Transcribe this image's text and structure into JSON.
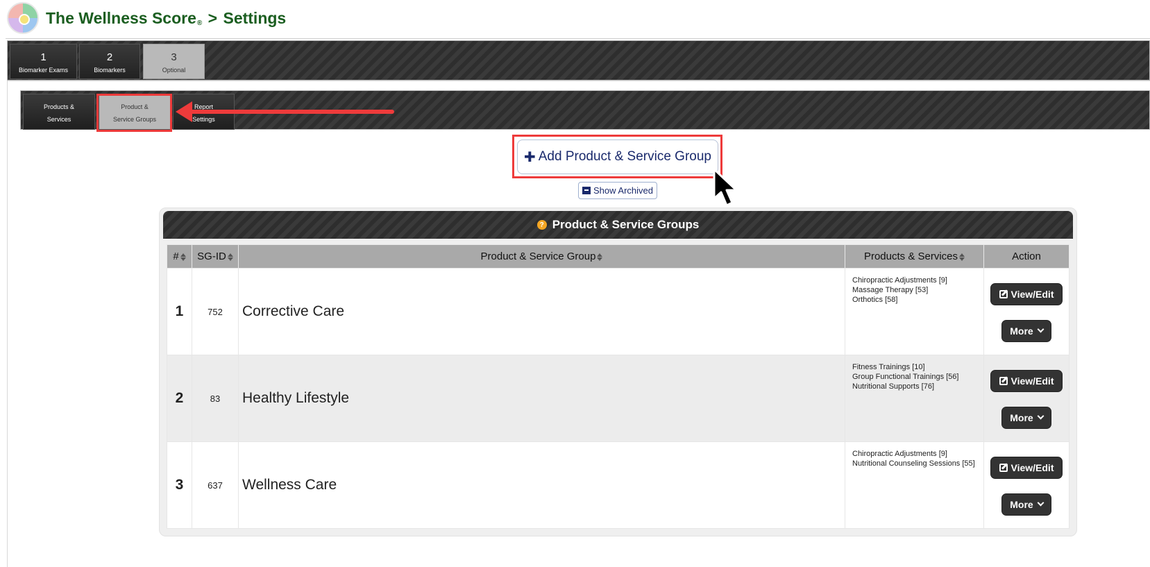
{
  "header": {
    "title": "The Wellness Score",
    "registered": "®",
    "separator": ">",
    "section": "Settings"
  },
  "top_tabs": [
    {
      "number": "1",
      "label": "Biomarker Exams",
      "active": false
    },
    {
      "number": "2",
      "label": "Biomarkers",
      "active": false
    },
    {
      "number": "3",
      "label": "Optional",
      "active": true
    }
  ],
  "sub_tabs": [
    {
      "line1": "Products &",
      "line2": "Services",
      "active": false
    },
    {
      "line1": "Product &",
      "line2": "Service Groups",
      "active": true
    },
    {
      "line1": "Report",
      "line2": "Settings",
      "active": false
    }
  ],
  "actions": {
    "add_label": "Add Product & Service Group",
    "add_icon": "plus-icon",
    "show_archived_label": "Show Archived",
    "archive_icon": "archive-box-icon"
  },
  "table": {
    "title": "Product & Service Groups",
    "help_icon": "question-circle-icon",
    "columns": {
      "num": "#",
      "sgid": "SG-ID",
      "group": "Product & Service Group",
      "products": "Products & Services",
      "action": "Action"
    },
    "view_label": "View/Edit",
    "more_label": "More",
    "rows": [
      {
        "num": "1",
        "sgid": "752",
        "name": "Corrective Care",
        "products": [
          "Chiropractic Adjustments [9]",
          "Massage Therapy [53]",
          "Orthotics [58]"
        ]
      },
      {
        "num": "2",
        "sgid": "83",
        "name": "Healthy Lifestyle",
        "products": [
          "Fitness Trainings [10]",
          "Group Functional Trainings [56]",
          "Nutritional Supports [76]"
        ]
      },
      {
        "num": "3",
        "sgid": "637",
        "name": "Wellness Care",
        "products": [
          "Chiropractic Adjustments [9]",
          "Nutritional Counseling Sessions [55]"
        ]
      }
    ]
  },
  "colors": {
    "title_green": "#1b5e20",
    "annotation_red": "#ee3b3b",
    "button_navy": "#1a2a6c",
    "help_orange": "#f5a623"
  }
}
